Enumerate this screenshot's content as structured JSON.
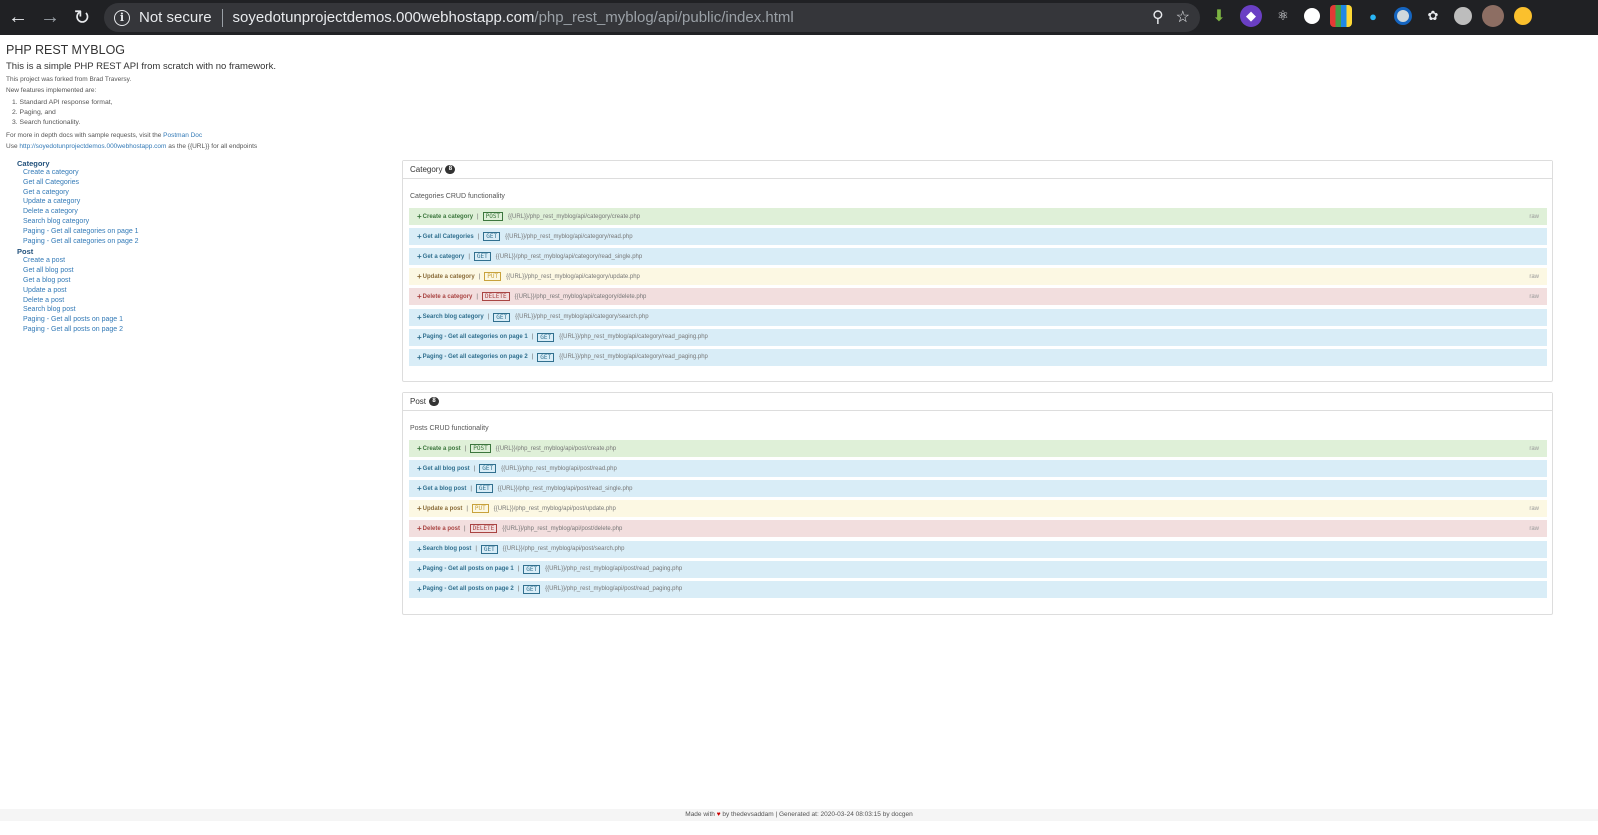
{
  "browser": {
    "security_label": "Not secure",
    "url_host": "soyedotunprojectdemos.000webhostapp.com",
    "url_path": "/php_rest_myblog/api/public/index.html"
  },
  "header": {
    "title": "PHP REST MYBLOG",
    "subtitle": "This is a simple PHP REST API from scratch with no framework.",
    "forked": "This project was forked from Brad Traversy.",
    "new_features": "New features implemented are:",
    "features": [
      "1. Standard API response format,",
      "2. Paging, and",
      "3. Search functionality."
    ],
    "docs_prefix": "For more in depth docs with sample requests, visit the ",
    "docs_link": "Postman Doc",
    "use_prefix": "Use ",
    "use_link": "http://soyedotunprojectdemos.000webhostapp.com",
    "use_suffix": " as the {{URL}} for all endpoints"
  },
  "toc": {
    "category_label": "Category",
    "category_items": [
      "Create a category",
      "Get all Categories",
      "Get a category",
      "Update a category",
      "Delete a category",
      "Search blog category",
      "Paging - Get all categories on page 1",
      "Paging - Get all categories on page 2"
    ],
    "post_label": "Post",
    "post_items": [
      "Create a post",
      "Get all blog post",
      "Get a blog post",
      "Update a post",
      "Delete a post",
      "Search blog post",
      "Paging - Get all posts on page 1",
      "Paging - Get all posts on page 2"
    ]
  },
  "category_panel": {
    "title": "Category",
    "count": "8",
    "description": "Categories CRUD functionality",
    "endpoints": [
      {
        "name": "Create a category",
        "method": "POST",
        "url": "{{URL}}/php_rest_myblog/api/category/create.php",
        "flag": "raw"
      },
      {
        "name": "Get all Categories",
        "method": "GET",
        "url": "{{URL}}/php_rest_myblog/api/category/read.php",
        "flag": ""
      },
      {
        "name": "Get a category",
        "method": "GET",
        "url": "{{URL}}/php_rest_myblog/api/category/read_single.php",
        "flag": ""
      },
      {
        "name": "Update a category",
        "method": "PUT",
        "url": "{{URL}}/php_rest_myblog/api/category/update.php",
        "flag": "raw"
      },
      {
        "name": "Delete a category",
        "method": "DELETE",
        "url": "{{URL}}/php_rest_myblog/api/category/delete.php",
        "flag": "raw"
      },
      {
        "name": "Search blog category",
        "method": "GET",
        "url": "{{URL}}/php_rest_myblog/api/category/search.php",
        "flag": ""
      },
      {
        "name": "Paging - Get all categories on page 1",
        "method": "GET",
        "url": "{{URL}}/php_rest_myblog/api/category/read_paging.php",
        "flag": ""
      },
      {
        "name": "Paging - Get all categories on page 2",
        "method": "GET",
        "url": "{{URL}}/php_rest_myblog/api/category/read_paging.php",
        "flag": ""
      }
    ]
  },
  "post_panel": {
    "title": "Post",
    "count": "8",
    "description": "Posts CRUD functionality",
    "endpoints": [
      {
        "name": "Create a post",
        "method": "POST",
        "url": "{{URL}}/php_rest_myblog/api/post/create.php",
        "flag": "raw"
      },
      {
        "name": "Get all blog post",
        "method": "GET",
        "url": "{{URL}}/php_rest_myblog/api/post/read.php",
        "flag": ""
      },
      {
        "name": "Get a blog post",
        "method": "GET",
        "url": "{{URL}}/php_rest_myblog/api/post/read_single.php",
        "flag": ""
      },
      {
        "name": "Update a post",
        "method": "PUT",
        "url": "{{URL}}/php_rest_myblog/api/post/update.php",
        "flag": "raw"
      },
      {
        "name": "Delete a post",
        "method": "DELETE",
        "url": "{{URL}}/php_rest_myblog/api/post/delete.php",
        "flag": "raw"
      },
      {
        "name": "Search blog post",
        "method": "GET",
        "url": "{{URL}}/php_rest_myblog/api/post/search.php",
        "flag": ""
      },
      {
        "name": "Paging - Get all posts on page 1",
        "method": "GET",
        "url": "{{URL}}/php_rest_myblog/api/post/read_paging.php",
        "flag": ""
      },
      {
        "name": "Paging - Get all posts on page 2",
        "method": "GET",
        "url": "{{URL}}/php_rest_myblog/api/post/read_paging.php",
        "flag": ""
      }
    ]
  },
  "footer": {
    "made_with": "Made with",
    "heart": "♥",
    "rest": " by thedevsaddam | Generated at: 2020-03-24 08:03:15 by docgen"
  }
}
